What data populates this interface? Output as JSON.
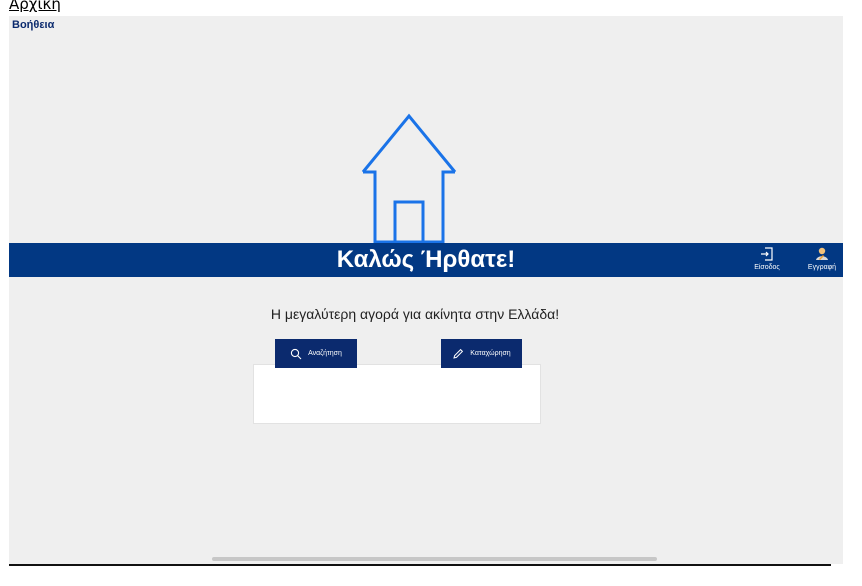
{
  "nav": {
    "home_link": "Αρχική",
    "help_link": "Βοήθεια"
  },
  "icons": {
    "hero": "house-icon",
    "login": "login-icon",
    "register": "user-icon",
    "search": "search-icon",
    "listing": "pencil-icon"
  },
  "banner": {
    "title": "Καλώς Ήρθατε!",
    "login_label": "Είσοδος",
    "register_label": "Εγγραφή"
  },
  "main": {
    "tagline": "Η μεγαλύτερη αγορά για ακίνητα στην Ελλάδα!",
    "search_label": "Αναζήτηση",
    "listing_label": "Καταχώρηση"
  },
  "colors": {
    "brand": "#023883",
    "button": "#0b2a6e",
    "icon_blue": "#1a73e8",
    "background": "#efefef"
  }
}
